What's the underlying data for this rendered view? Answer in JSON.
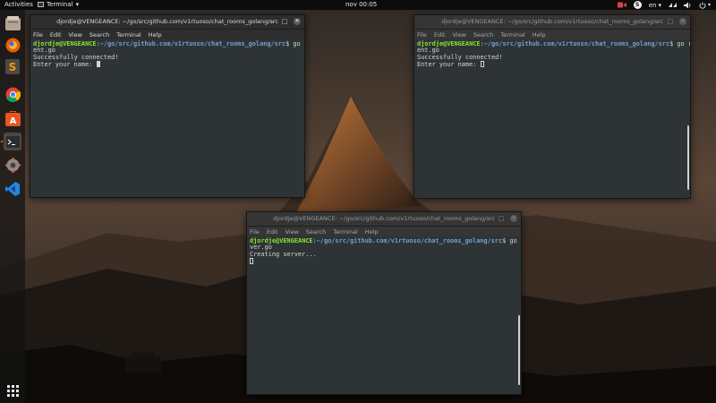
{
  "topbar": {
    "activities": "Activities",
    "app_menu": "Terminal",
    "clock": "nov 00:05",
    "language": "en"
  },
  "dock": {
    "items": [
      {
        "name": "files-icon"
      },
      {
        "name": "firefox-icon"
      },
      {
        "name": "sublime-text-icon"
      },
      {
        "name": "chrome-icon"
      },
      {
        "name": "software-center-icon"
      },
      {
        "name": "terminal-icon"
      },
      {
        "name": "settings-icon"
      },
      {
        "name": "vscode-icon"
      }
    ],
    "show_apps": "show-applications-icon"
  },
  "terminals": {
    "left": {
      "title": "djordje@VENGEANCE: ~/go/src/github.com/v1rtuoso/chat_rooms_golang/src",
      "menu": [
        "File",
        "Edit",
        "View",
        "Search",
        "Terminal",
        "Help"
      ],
      "user": "djordje@VENGEANCE",
      "path": ":~/go/src/github.com/v1rtuoso/chat_rooms_golang/src",
      "command_a": "$ go run cli",
      "command_b": "ent.go",
      "line1": "Successfully connected!",
      "line2": "Enter your name: "
    },
    "right": {
      "title": "djordje@VENGEANCE: ~/go/src/github.com/v1rtuoso/chat_rooms_golang/src",
      "menu": [
        "File",
        "Edit",
        "View",
        "Search",
        "Terminal",
        "Help"
      ],
      "user": "djordje@VENGEANCE",
      "path": ":~/go/src/github.com/v1rtuoso/chat_rooms_golang/src",
      "command_a": "$ go run cli",
      "command_b": "ent.go",
      "line1": "Successfully connected!",
      "line2": "Enter your name: "
    },
    "bottom": {
      "title": "djordje@VENGEANCE: ~/go/src/github.com/v1rtuoso/chat_rooms_golang/src",
      "menu": [
        "File",
        "Edit",
        "View",
        "Search",
        "Terminal",
        "Help"
      ],
      "user": "djordje@VENGEANCE",
      "path": ":~/go/src/github.com/v1rtuoso/chat_rooms_golang/src",
      "command_a": "$ go run ser",
      "command_b": "ver.go",
      "line1": "Creating server..."
    }
  },
  "colors": {
    "prompt_user": "#8ae234",
    "prompt_path": "#729fcf",
    "terminal_bg": "#2e3436",
    "accent_dock": "#f08a24"
  }
}
